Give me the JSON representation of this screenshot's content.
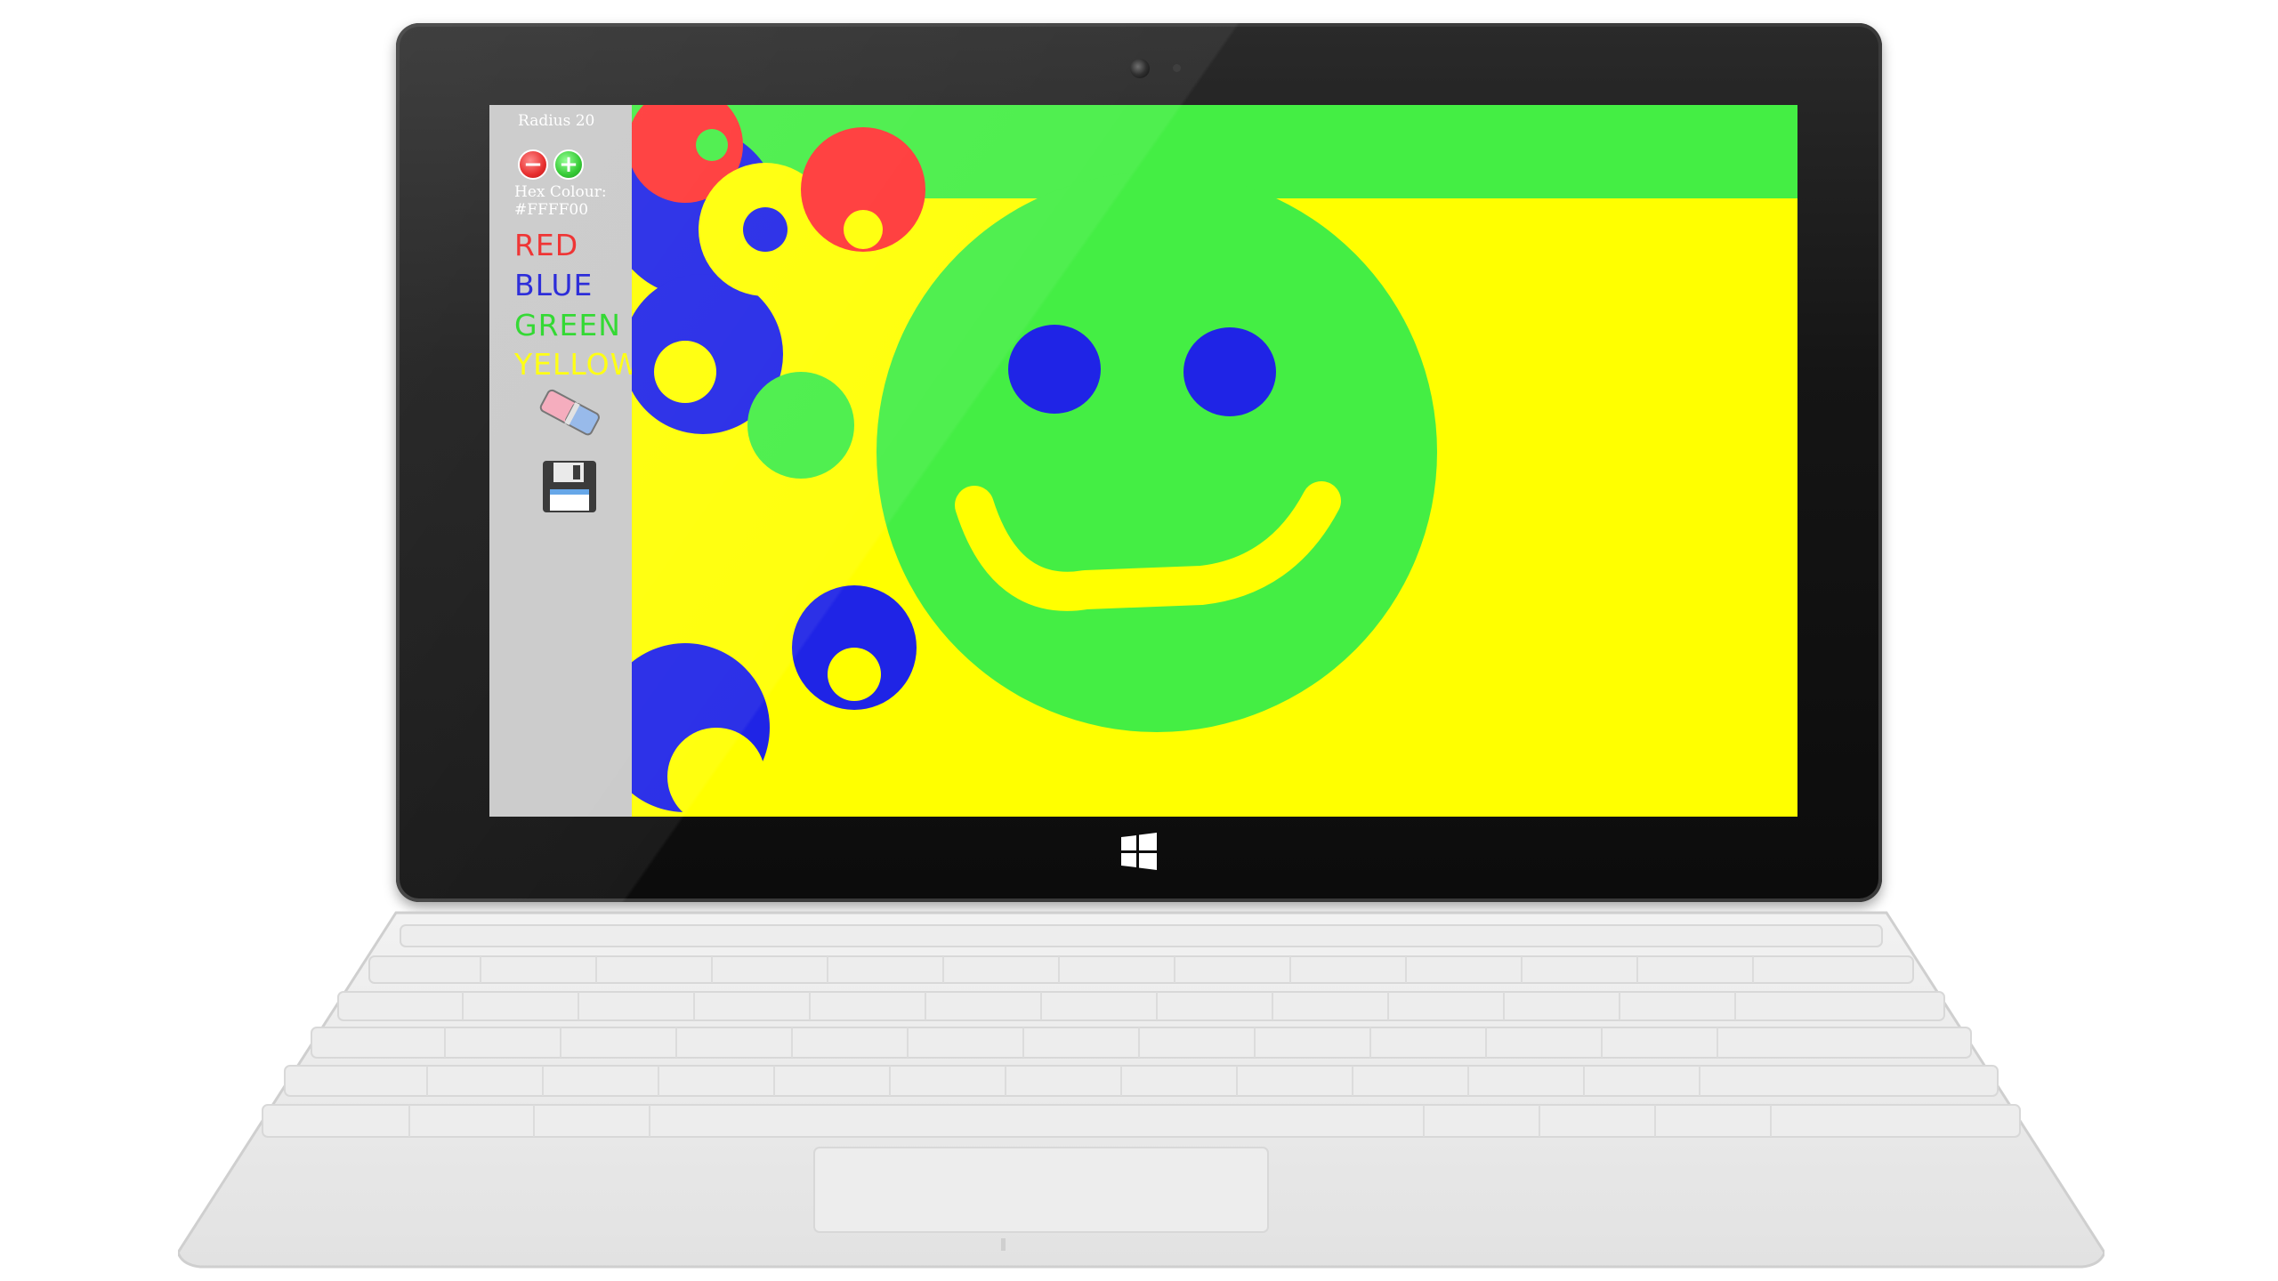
{
  "toolbar": {
    "radius_label": "Radius 20",
    "decrease_symbol": "−",
    "increase_symbol": "+",
    "hex_label": "Hex Colour:",
    "hex_value": "#FFFF00",
    "color_options": [
      {
        "label": "RED",
        "color": "#ee2222"
      },
      {
        "label": "BLUE",
        "color": "#1a1ad6"
      },
      {
        "label": "GREEN",
        "color": "#22d622"
      },
      {
        "label": "YELLOW",
        "color": "#ffff00"
      }
    ],
    "eraser_icon": "eraser-icon",
    "save_icon": "floppy-disk-icon"
  },
  "canvas": {
    "background_color": "#ffff00",
    "palette": {
      "red": "#ff3333",
      "blue": "#1f24e6",
      "green": "#44ee44",
      "yellow": "#ffff00"
    }
  },
  "device": {
    "logo_icon": "windows-logo-icon"
  }
}
